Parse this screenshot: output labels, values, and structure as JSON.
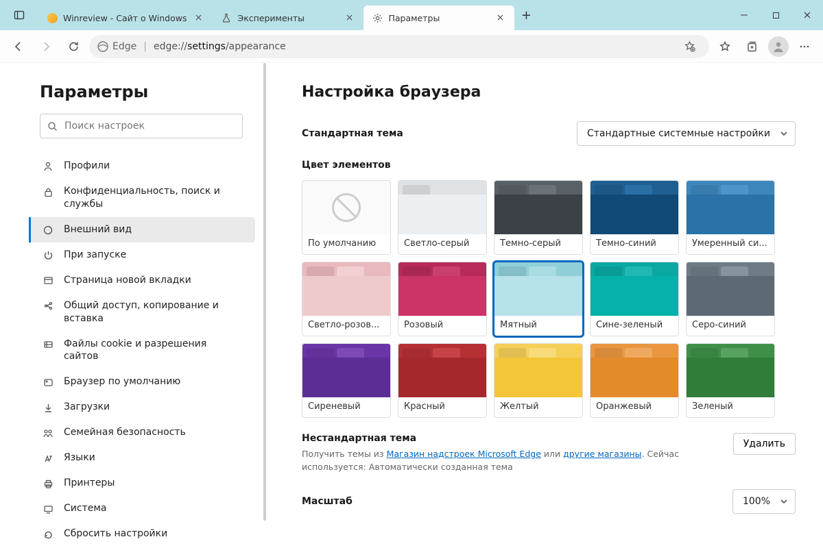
{
  "window": {
    "tabs": [
      {
        "label": "Winreview - Сайт о Windows",
        "icon": "globe"
      },
      {
        "label": "Эксперименты",
        "icon": "flask"
      },
      {
        "label": "Параметры",
        "icon": "gear",
        "active": true
      }
    ]
  },
  "addressbar": {
    "product": "Edge",
    "url_prefix": "edge://",
    "url_bold": "settings",
    "url_suffix": "/appearance"
  },
  "sidebar": {
    "title": "Параметры",
    "search_placeholder": "Поиск настроек",
    "items": [
      {
        "label": "Профили",
        "icon": "person"
      },
      {
        "label": "Конфиденциальность, поиск и службы",
        "icon": "lock"
      },
      {
        "label": "Внешний вид",
        "icon": "brush",
        "active": true
      },
      {
        "label": "При запуске",
        "icon": "power"
      },
      {
        "label": "Страница новой вкладки",
        "icon": "window"
      },
      {
        "label": "Общий доступ, копирование и вставка",
        "icon": "share"
      },
      {
        "label": "Файлы cookie и разрешения сайтов",
        "icon": "cookie"
      },
      {
        "label": "Браузер по умолчанию",
        "icon": "default"
      },
      {
        "label": "Загрузки",
        "icon": "download"
      },
      {
        "label": "Семейная безопасность",
        "icon": "family"
      },
      {
        "label": "Языки",
        "icon": "lang"
      },
      {
        "label": "Принтеры",
        "icon": "printer"
      },
      {
        "label": "Система",
        "icon": "system"
      },
      {
        "label": "Сбросить настройки",
        "icon": "reset"
      }
    ]
  },
  "main": {
    "heading": "Настройка браузера",
    "default_theme_label": "Стандартная тема",
    "default_theme_value": "Стандартные системные настройки",
    "color_section_label": "Цвет элементов",
    "swatches": [
      {
        "label": "По умолчанию",
        "default": true
      },
      {
        "label": "Светло-серый",
        "tab1": "#dfe2e4",
        "tab2": "#dfe2e4",
        "body": "#eceff1"
      },
      {
        "label": "Темно-серый",
        "tab1": "#596066",
        "tab2": "#6a7177",
        "body": "#3b4146"
      },
      {
        "label": "Темно-синий",
        "tab1": "#1f5f91",
        "tab2": "#2a6fa3",
        "body": "#114a77"
      },
      {
        "label": "Умеренный си...",
        "tab1": "#3e87bd",
        "tab2": "#4d94c9",
        "body": "#2a72a7"
      },
      {
        "label": "Светло-розов...",
        "tab1": "#e9b9bd",
        "tab2": "#f2cfd2",
        "body": "#eecacd"
      },
      {
        "label": "Розовый",
        "tab1": "#b82a5a",
        "tab2": "#c93f6e",
        "body": "#cc3367"
      },
      {
        "label": "Мятный",
        "tab1": "#8fcfd8",
        "tab2": "#a9dbe2",
        "body": "#b6e2e9",
        "selected": true
      },
      {
        "label": "Сине-зеленый",
        "tab1": "#0aa8a3",
        "tab2": "#1fb8b3",
        "body": "#06b0ab"
      },
      {
        "label": "Серо-синий",
        "tab1": "#6f7b86",
        "tab2": "#8893a0",
        "body": "#5d6a76"
      },
      {
        "label": "Сиреневый",
        "tab1": "#6a35a6",
        "tab2": "#7d4ab6",
        "body": "#5d2d96"
      },
      {
        "label": "Красный",
        "tab1": "#b43035",
        "tab2": "#c64449",
        "body": "#a5282d"
      },
      {
        "label": "Желтый",
        "tab1": "#f5cf57",
        "tab2": "#f8da79",
        "body": "#f3c638"
      },
      {
        "label": "Оранжевый",
        "tab1": "#e9963f",
        "tab2": "#efa95e",
        "body": "#e38a2b"
      },
      {
        "label": "Зеленый",
        "tab1": "#3f8f49",
        "tab2": "#57a260",
        "body": "#2f7d39"
      }
    ],
    "nonstandard_theme_label": "Нестандартная тема",
    "delete_button": "Удалить",
    "theme_hint_prefix": "Получить темы из ",
    "theme_hint_link1": "Магазин надстроек Microsoft Edge",
    "theme_hint_mid": " или ",
    "theme_hint_link2": "другие магазины",
    "theme_hint_suffix": ". Сейчас используется: ",
    "theme_current": "Автоматически созданная тема",
    "scale_label": "Масштаб",
    "scale_value": "100%"
  }
}
